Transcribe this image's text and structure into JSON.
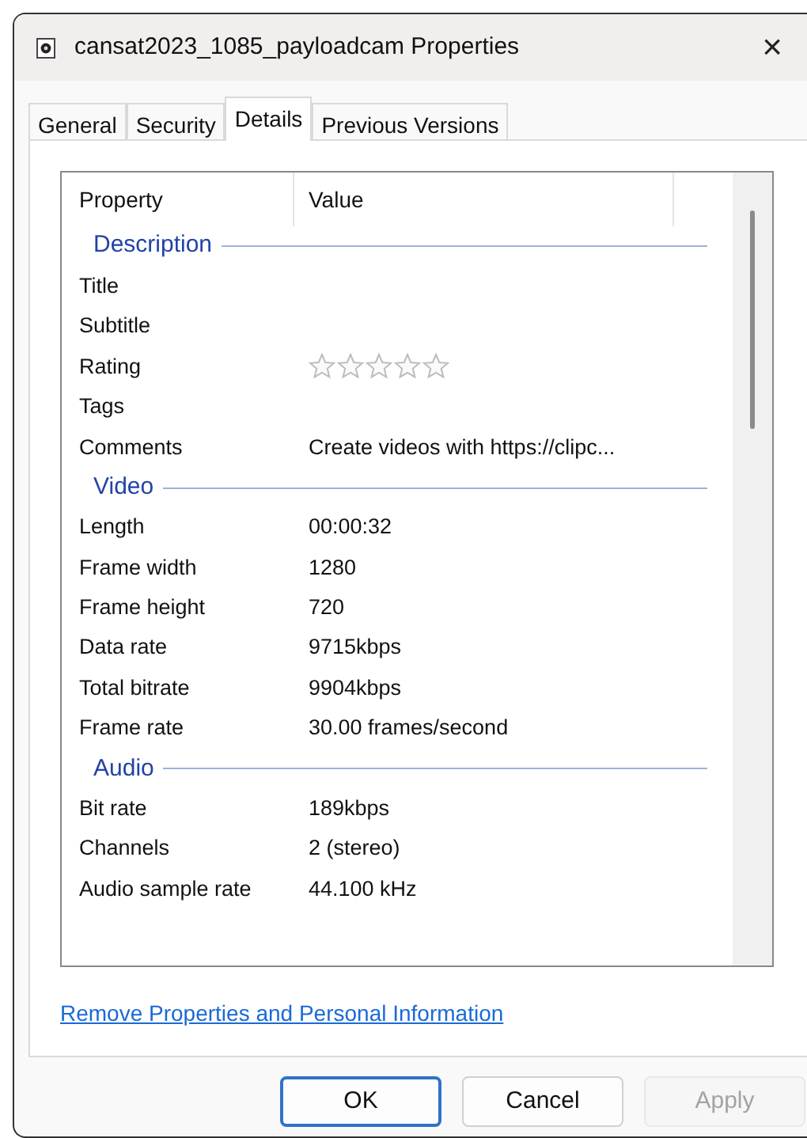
{
  "window": {
    "title": "cansat2023_1085_payloadcam Properties",
    "close": "×"
  },
  "tabs": [
    {
      "label": "General",
      "selected": false
    },
    {
      "label": "Security",
      "selected": false
    },
    {
      "label": "Details",
      "selected": true
    },
    {
      "label": "Previous Versions",
      "selected": false
    }
  ],
  "table": {
    "columns": [
      "Property",
      "Value"
    ],
    "rows": [
      {
        "kind": "section",
        "label": "Description"
      },
      {
        "kind": "field",
        "label": "Title"
      },
      {
        "kind": "field",
        "label": "Subtitle"
      },
      {
        "kind": "rating",
        "label": "Rating",
        "stars": 0
      },
      {
        "kind": "field",
        "label": "Tags"
      },
      {
        "kind": "field",
        "label": "Comments",
        "value": "Create videos with https://clipc..."
      },
      {
        "kind": "section",
        "label": "Video"
      },
      {
        "kind": "field",
        "label": "Length",
        "value": "00:00:32"
      },
      {
        "kind": "field",
        "label": "Frame width",
        "value": "1280"
      },
      {
        "kind": "field",
        "label": "Frame height",
        "value": "720"
      },
      {
        "kind": "field",
        "label": "Data rate",
        "value": "9715kbps"
      },
      {
        "kind": "field",
        "label": "Total bitrate",
        "value": "9904kbps"
      },
      {
        "kind": "field",
        "label": "Frame rate",
        "value": "30.00 frames/second"
      },
      {
        "kind": "section",
        "label": "Audio"
      },
      {
        "kind": "field",
        "label": "Bit rate",
        "value": "189kbps"
      },
      {
        "kind": "field",
        "label": "Channels",
        "value": "2 (stereo)"
      },
      {
        "kind": "field",
        "label": "Audio sample rate",
        "value": "44.100 kHz"
      }
    ]
  },
  "link": "Remove Properties and Personal Information",
  "buttons": [
    {
      "label": "OK",
      "disabled": false,
      "default": true
    },
    {
      "label": "Cancel",
      "disabled": false,
      "default": false
    },
    {
      "label": "Apply",
      "disabled": true,
      "default": false
    }
  ]
}
